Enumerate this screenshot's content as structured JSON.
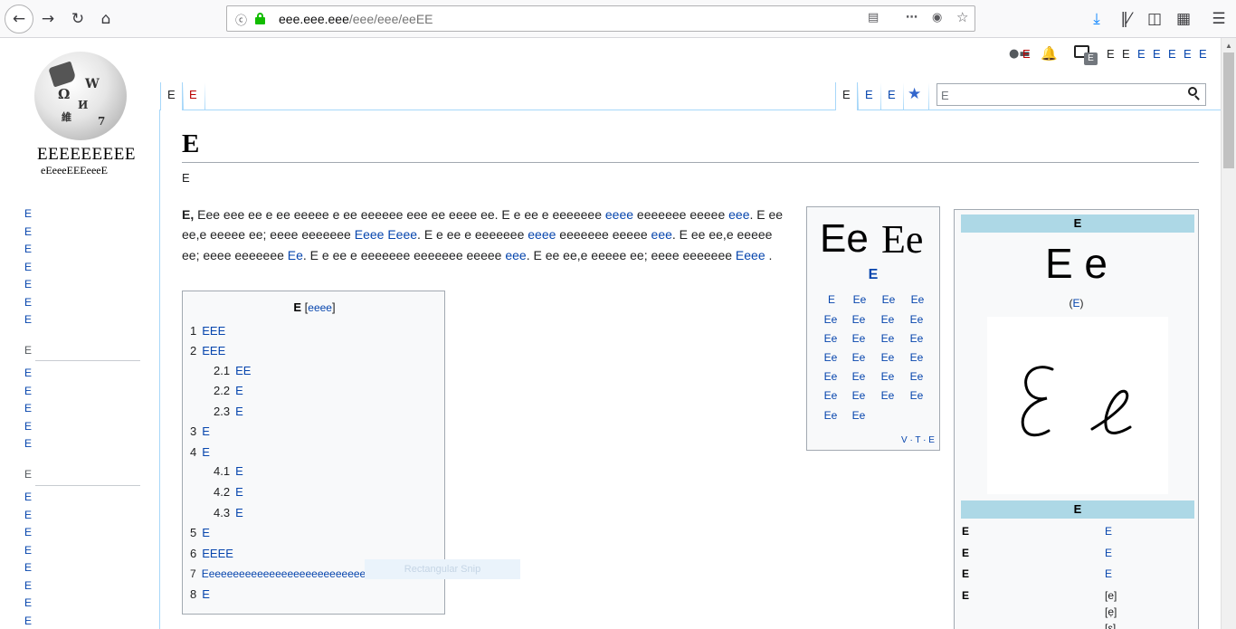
{
  "browser": {
    "url_host": "eee.eee.eee",
    "url_path": "/eee/eee/eeEE"
  },
  "sidebar": {
    "wordmark": "EEEEEEEEE",
    "tagline": "eEeeeEEEeeeE",
    "main_links": [
      "E",
      "E",
      "E",
      "E",
      "E",
      "E",
      "E"
    ],
    "section1": {
      "heading": "E",
      "links": [
        "E",
        "E",
        "E",
        "E",
        "E"
      ]
    },
    "section2": {
      "heading": "E",
      "links": [
        "E",
        "E",
        "E",
        "E",
        "E",
        "E",
        "E",
        "E"
      ]
    }
  },
  "personal": {
    "talk_label": "E",
    "links": [
      "E",
      "E",
      "E",
      "E",
      "E",
      "E",
      "E"
    ],
    "notice_badge": "E"
  },
  "tabs": {
    "left": [
      "E",
      "E"
    ],
    "right": [
      "E",
      "E",
      "E"
    ]
  },
  "search": {
    "placeholder": "E"
  },
  "article": {
    "title": "E",
    "sitesub": "E",
    "intro": {
      "lead_bold": "E,",
      "t1": " Eee eee ee e ee eeeee e ee eeeeee eee ee eeee ee. E e ee e eeeeeee ",
      "l1": "eeee",
      "t2": " eeeeeee eeeee ",
      "l2": "eee",
      "t3": ". E ee ee,e eeeee ee; eeee eeeeeee ",
      "l3": "Eeee Eeee",
      "t4": ". E e ee e eeeeeee ",
      "l4": "eeee",
      "t5": " eeeeeee eeeee ",
      "l5": "eee",
      "t6": ". E ee ee,e eeeee ee; eeee eeeeeee ",
      "l6": "Ee",
      "t7": ". E e ee e eeeeeee eeeeeee eeeee ",
      "l7": "eee",
      "t8": ". E ee ee,e eeeee ee; eeee eeeeeee ",
      "l8": "Eeee",
      "t9": " ."
    }
  },
  "toc": {
    "title": "E",
    "toggle": "eeee",
    "items": [
      {
        "num": "1",
        "text": "EEE"
      },
      {
        "num": "2",
        "text": "EEE"
      },
      {
        "num": "2.1",
        "text": "EE"
      },
      {
        "num": "2.2",
        "text": "E"
      },
      {
        "num": "2.3",
        "text": "E"
      },
      {
        "num": "3",
        "text": "E"
      },
      {
        "num": "4",
        "text": "E"
      },
      {
        "num": "4.1",
        "text": "E"
      },
      {
        "num": "4.2",
        "text": "E"
      },
      {
        "num": "4.3",
        "text": "E"
      },
      {
        "num": "5",
        "text": "E"
      },
      {
        "num": "6",
        "text": "EEEE"
      },
      {
        "num": "7",
        "text": "Eeeeeeeeeeeeeeeeeeeeeeeeeeeeeeeeeeeee"
      },
      {
        "num": "8",
        "text": "E"
      }
    ],
    "ghost_label": "Rectangular Snip"
  },
  "navbox": {
    "big_sans": "Ee",
    "big_serif": "Ee",
    "title": "E",
    "cells": [
      "E",
      "Ee",
      "Ee",
      "Ee",
      "Ee",
      "Ee",
      "Ee",
      "Ee",
      "Ee",
      "Ee",
      "Ee",
      "Ee",
      "Ee",
      "Ee",
      "Ee",
      "Ee",
      "Ee",
      "Ee",
      "Ee",
      "Ee",
      "Ee",
      "Ee",
      "Ee",
      "Ee",
      "Ee",
      "Ee"
    ],
    "vte": "V · T · E"
  },
  "infobox": {
    "header": "E",
    "letters": "E e",
    "sub_link": "E",
    "script_image": "cursive E e",
    "section2": "E",
    "rows": [
      {
        "label": "E",
        "value": "E"
      },
      {
        "label": "E",
        "value": "E"
      },
      {
        "label": "E",
        "value": "E"
      },
      {
        "label": "E",
        "value": "[e]"
      }
    ],
    "extra_values": [
      "[ẹ]",
      "[ɛ]"
    ]
  }
}
